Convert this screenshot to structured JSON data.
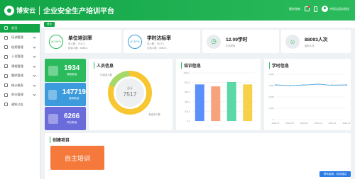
{
  "header": {
    "brand": "博安云",
    "title": "企业安全生产培训平台",
    "right": {
      "link": "操作指南",
      "user": "中科达培训测试"
    }
  },
  "sidebar": {
    "items": [
      {
        "label": "首页"
      },
      {
        "label": "培训管理"
      },
      {
        "label": "档案管理"
      },
      {
        "label": "人员管理"
      },
      {
        "label": "课程管理"
      },
      {
        "label": "题库管理"
      },
      {
        "label": "统计报表"
      },
      {
        "label": "积分管理"
      },
      {
        "label": "通知公告"
      }
    ]
  },
  "tabs": [
    {
      "label": "首页"
    }
  ],
  "stats": [
    {
      "ring": "80.94%",
      "title": "单位培训率",
      "sub1": "总人数：7517人",
      "sub2": "培训人数：6084人"
    },
    {
      "ring": "40.57%",
      "title": "学时达标率",
      "sub1": "总人数：7517人",
      "sub2": "达标人数：3050人"
    },
    {
      "title": "12.09学时",
      "sub1": "平均学时"
    },
    {
      "title": "88093人次",
      "sub1": "培训人次"
    }
  ],
  "tiles": [
    {
      "value": "1934",
      "label": "课程数量",
      "color": "#2bbb5c"
    },
    {
      "value": "147719",
      "label": "题库数量",
      "color": "#3b9bdc"
    },
    {
      "value": "6266",
      "label": "项目数量",
      "color": "#6b6cdc"
    }
  ],
  "panels": {
    "person": "人员信息",
    "train": "培训信息",
    "hours": "学时信息",
    "create": "创建项目"
  },
  "donut": {
    "center_label": "总计",
    "center_value": "7517",
    "legend": [
      "已培训人数",
      "未培训人数"
    ]
  },
  "chart_data": [
    {
      "type": "bar",
      "categories": [
        "",
        "",
        "",
        ""
      ],
      "values": [
        760,
        720,
        810,
        760
      ],
      "ylim": [
        0,
        1000
      ],
      "ticks": [
        "1000人",
        "800人",
        "600人",
        "400人",
        "200人",
        "0人"
      ],
      "colors": [
        "#5b8ff9",
        "#f7a27d",
        "#5ad8a6",
        "#f6d24a"
      ]
    },
    {
      "type": "line",
      "categories": [
        "2022-07",
        "2022-08",
        "2022-09",
        "2022-10",
        "2022-11",
        "2022-12"
      ],
      "values": [
        3060,
        3000,
        3050,
        3120,
        3040,
        3060
      ],
      "ylim": [
        0,
        4000
      ],
      "ticks": [
        "4,000",
        "3,000",
        "2,000",
        "1,000",
        "0"
      ],
      "color": "#3b9bdc"
    }
  ],
  "create": {
    "button": "自主培训"
  },
  "fab": {
    "label": "联系客服，投诉建议"
  }
}
